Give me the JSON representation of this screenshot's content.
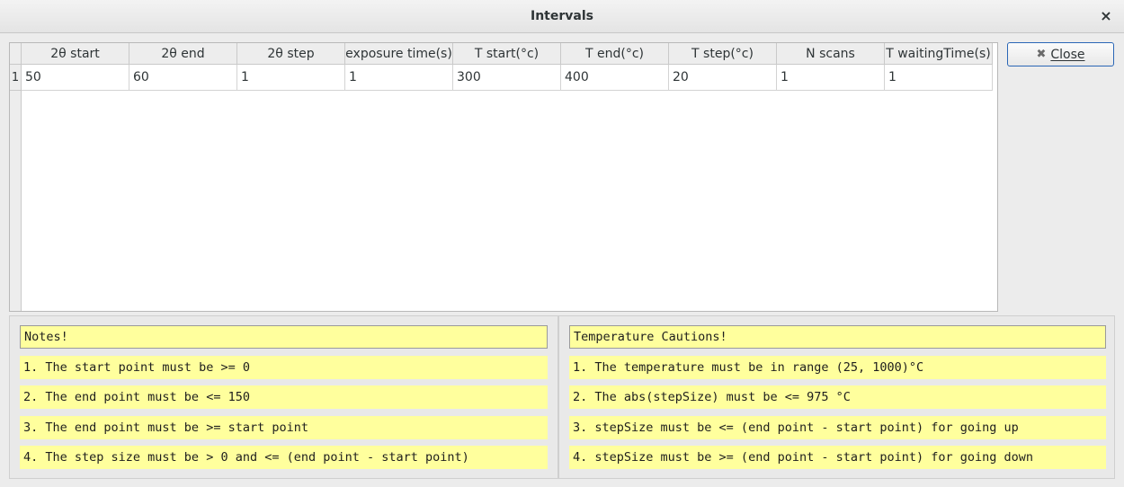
{
  "window": {
    "title": "Intervals",
    "close_glyph": "×"
  },
  "table": {
    "headers": [
      "2θ start",
      "2θ end",
      "2θ step",
      "exposure time(s)",
      "T start(°c)",
      "T end(°c)",
      "T step(°c)",
      "N scans",
      "T waitingTime(s)"
    ],
    "rows": [
      {
        "num": "1",
        "cells": [
          "50",
          "60",
          "1",
          "1",
          "300",
          "400",
          "20",
          "1",
          "1"
        ]
      }
    ]
  },
  "close_button": {
    "label": "Close",
    "icon": "close-x-icon"
  },
  "notes": {
    "title": "Notes!",
    "items": [
      "1. The start point must be >= 0",
      "2. The end point must be <= 150",
      "3. The end point must be >= start point",
      "4. The step size must be > 0 and <= (end point - start point)"
    ]
  },
  "cautions": {
    "title": "Temperature Cautions!",
    "items": [
      "1. The temperature must be in range (25, 1000)°C",
      "2. The abs(stepSize) must be <= 975 °C",
      "3. stepSize must be <= (end point - start point) for going up",
      "4. stepSize must be >= (end point - start point) for going down"
    ]
  },
  "colors": {
    "note_bg": "#ffff9d",
    "focus_border": "#2a66b6"
  }
}
